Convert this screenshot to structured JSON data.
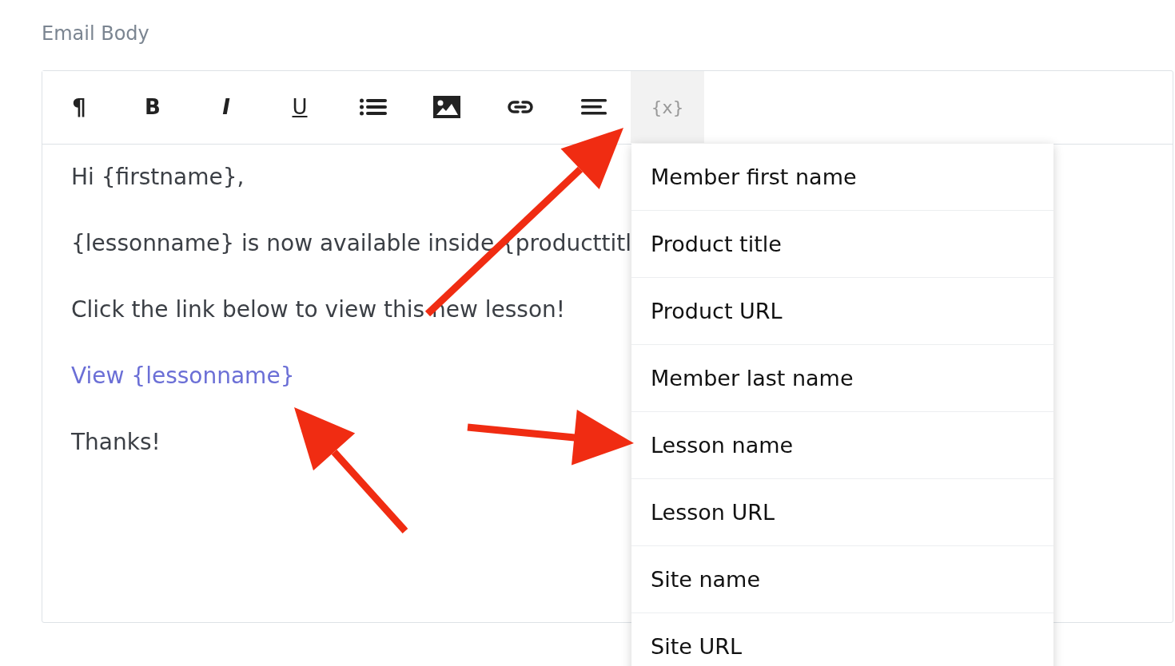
{
  "field_label": "Email Body",
  "toolbar": [
    {
      "kind": "paragraph",
      "label": "¶",
      "selected": false
    },
    {
      "kind": "bold",
      "label": "B",
      "selected": false
    },
    {
      "kind": "italic",
      "label": "I",
      "selected": false
    },
    {
      "kind": "underline",
      "label": "U",
      "selected": false
    },
    {
      "kind": "list",
      "selected": false
    },
    {
      "kind": "image",
      "selected": false
    },
    {
      "kind": "link",
      "selected": false
    },
    {
      "kind": "align",
      "selected": false
    },
    {
      "kind": "variable",
      "label": "{x}",
      "selected": true
    }
  ],
  "body": [
    {
      "kind": "text",
      "text": "Hi {firstname},"
    },
    {
      "kind": "text",
      "text": "{lessonname} is now available inside {producttitl"
    },
    {
      "kind": "text",
      "text": "Click the link below to view this new lesson!"
    },
    {
      "kind": "link",
      "text": "View {lessonname}"
    },
    {
      "kind": "text",
      "text": "Thanks!"
    }
  ],
  "variable_menu": [
    "Member first name",
    "Product title",
    "Product URL",
    "Member last name",
    "Lesson name",
    "Lesson URL",
    "Site name",
    "Site URL"
  ]
}
